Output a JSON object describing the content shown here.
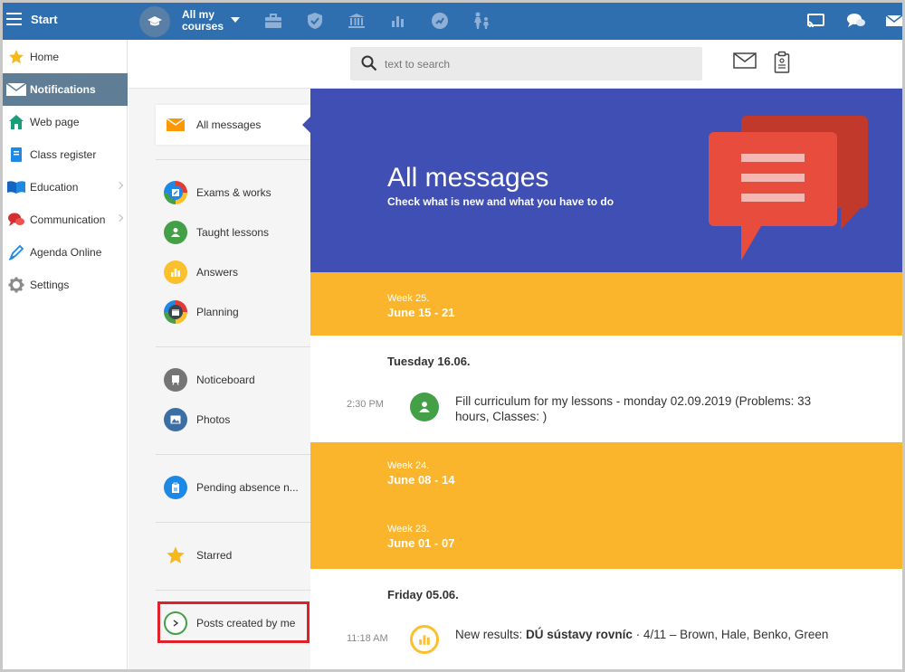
{
  "topbar": {
    "start_label": "Start",
    "course_label": "All my courses"
  },
  "leftnav": {
    "items": [
      {
        "label": "Home",
        "icon": "star-icon"
      },
      {
        "label": "Notifications",
        "icon": "envelope-icon",
        "active": true
      },
      {
        "label": "Web page",
        "icon": "house-icon"
      },
      {
        "label": "Class register",
        "icon": "notebook-icon"
      },
      {
        "label": "Education",
        "icon": "book-icon"
      },
      {
        "label": "Communication",
        "icon": "chat-icon"
      },
      {
        "label": "Agenda Online",
        "icon": "pen-icon"
      },
      {
        "label": "Settings",
        "icon": "gear-icon"
      }
    ]
  },
  "search": {
    "placeholder": "text to search"
  },
  "filters": {
    "all_messages": "All messages",
    "exams_works": "Exams & works",
    "taught_lessons": "Taught lessons",
    "answers": "Answers",
    "planning": "Planning",
    "noticeboard": "Noticeboard",
    "photos": "Photos",
    "pending_absence": "Pending absence n...",
    "starred": "Starred",
    "posts_created": "Posts created by me"
  },
  "hero": {
    "title": "All messages",
    "subtitle": "Check what is new and what you have to do"
  },
  "timeline": {
    "week25": {
      "week": "Week 25.",
      "range": "June 15 - 21"
    },
    "day1": "Tuesday 16.06.",
    "msg1": {
      "time": "2:30 PM",
      "text": "Fill curriculum for my lessons - monday 02.09.2019 (Problems: 33 hours, Classes: )"
    },
    "week24": {
      "week": "Week 24.",
      "range": "June 08 - 14"
    },
    "week23": {
      "week": "Week 23.",
      "range": "June 01 - 07"
    },
    "day2": "Friday 05.06.",
    "msg2": {
      "time": "11:18 AM",
      "prefix": "New results: ",
      "bold": "DÚ sústavy rovníc",
      "suffix": " · 4/11 – Brown, Hale, Benko, Green"
    }
  },
  "colors": {
    "topbar": "#2f6fb0",
    "hero": "#3f4fb3",
    "week": "#fbb52c",
    "nav_active": "#5f7e95",
    "highlight": "#e0202a"
  }
}
